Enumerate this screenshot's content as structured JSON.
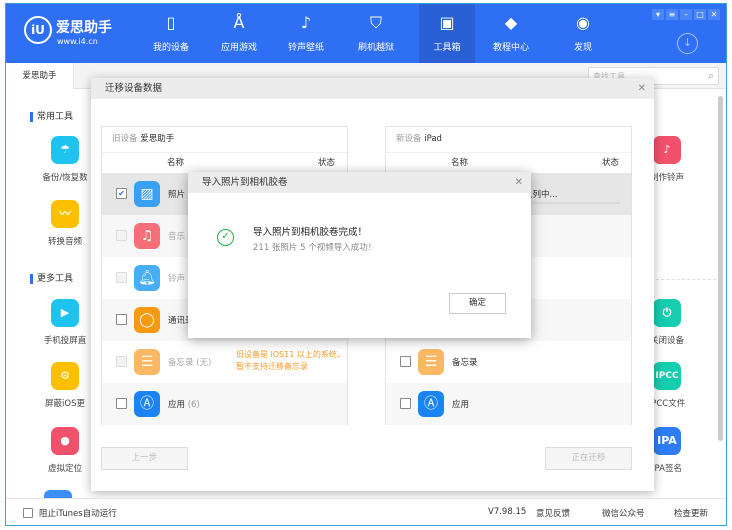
{
  "app": {
    "logo_name": "爱思助手",
    "logo_url": "www.i4.cn",
    "brand_color": "#2e6ff3"
  },
  "nav": [
    {
      "label": "我的设备",
      "icon": "phone-icon"
    },
    {
      "label": "应用游戏",
      "icon": "app-store-icon"
    },
    {
      "label": "铃声壁纸",
      "icon": "music-icon"
    },
    {
      "label": "刷机越狱",
      "icon": "shield-icon"
    },
    {
      "label": "工具箱",
      "icon": "toolbox-icon"
    },
    {
      "label": "教程中心",
      "icon": "graduation-icon"
    },
    {
      "label": "发现",
      "icon": "compass-icon"
    }
  ],
  "subbar": {
    "tab": "爱思助手",
    "search_placeholder": "查找工具"
  },
  "sidebar": {
    "section1": "常用工具",
    "section2": "更多工具",
    "left_tools": [
      "备份/恢复数",
      "转换音频",
      "手机投屏直",
      "屏蔽iOS更",
      "虚拟定位"
    ],
    "right_tools": [
      "制作铃声",
      "关闭设备",
      "IPCC文件",
      "IPA签名"
    ],
    "right_icon_text": [
      "IPCC",
      "IPA"
    ]
  },
  "migrate": {
    "title": "迁移设备数据",
    "old_label": "旧设备",
    "old_name": "爱思助手",
    "new_label": "新设备",
    "new_name": "iPad",
    "col_name": "名称",
    "col_status": "状态",
    "old_rows": [
      {
        "name": "照片",
        "checked": true
      },
      {
        "name": "音乐"
      },
      {
        "name": "铃声"
      },
      {
        "name": "通讯录"
      },
      {
        "name": "备忘录 (无)"
      },
      {
        "name": "应用",
        "count": "(6)"
      }
    ],
    "memo_warning": "旧设备是 iOS11 以上的系统，暂不支持迁移备忘录",
    "new_status": "队列中...",
    "new_rows": [
      "备忘录",
      "应用"
    ],
    "prev_btn": "上一步",
    "migrating_btn": "正在迁移"
  },
  "modal": {
    "title": "导入照片到相机胶卷",
    "heading": "导入照片到相机胶卷完成！",
    "detail": "211 张照片 5 个视频导入成功！",
    "ok": "确定",
    "success_color": "#22b04b"
  },
  "footer": {
    "itunes": "阻止iTunes自动运行",
    "version": "V7.98.15",
    "feedback": "意见反馈",
    "wechat": "微信公众号",
    "update": "检查更新"
  }
}
